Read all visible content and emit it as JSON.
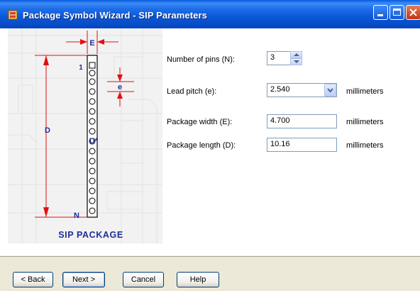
{
  "window": {
    "title": "Package Symbol Wizard - SIP Parameters"
  },
  "diagram": {
    "label_E": "E",
    "label_e": "e",
    "label_D": "D",
    "label_1": "1",
    "label_N": "N",
    "label_U": "U*",
    "caption": "SIP PACKAGE",
    "colors": {
      "dimension": "#E01010",
      "label": "#1F2E9A"
    }
  },
  "form": {
    "pins_label": "Number of pins (N):",
    "pins_value": "3",
    "pitch_label": "Lead pitch (e):",
    "pitch_value": "2.540",
    "pitch_unit": "millimeters",
    "width_label": "Package width (E):",
    "width_value": "4.700",
    "width_unit": "millimeters",
    "length_label": "Package length (D):",
    "length_value": "10.16",
    "length_unit": "millimeters"
  },
  "buttons": {
    "back": "< Back",
    "next": "Next >",
    "cancel": "Cancel",
    "help": "Help"
  }
}
